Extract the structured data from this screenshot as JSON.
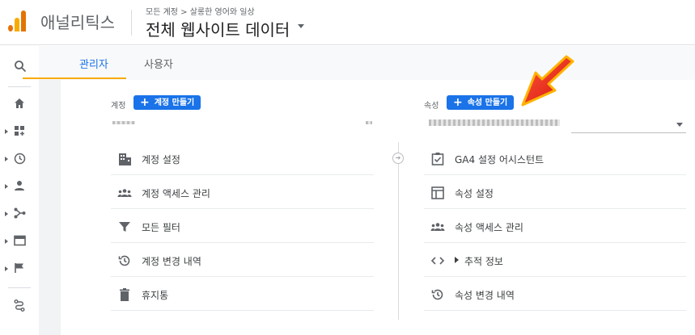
{
  "header": {
    "brand": "애널리틱스",
    "breadcrumb": "모든 계정 > 살롱한 영어와 일상",
    "property_title": "전체 웹사이트 데이터"
  },
  "tabs": [
    {
      "label": "관리자",
      "active": true
    },
    {
      "label": "사용자",
      "active": false
    }
  ],
  "rail": {
    "icons": [
      "search-icon",
      "home-icon",
      "dashboard-icon",
      "realtime-icon",
      "audience-icon",
      "acquisition-icon",
      "behavior-icon",
      "conversions-icon",
      "attribution-icon"
    ]
  },
  "account": {
    "label": "계정",
    "create_button": "계정 만들기",
    "items": [
      {
        "icon": "building-icon",
        "label": "계정 설정"
      },
      {
        "icon": "people-icon",
        "label": "계정 액세스 관리"
      },
      {
        "icon": "filter-icon",
        "label": "모든 필터"
      },
      {
        "icon": "history-icon",
        "label": "계정 변경 내역"
      },
      {
        "icon": "trash-icon",
        "label": "휴지통"
      }
    ]
  },
  "property": {
    "label": "속성",
    "create_button": "속성 만들기",
    "items": [
      {
        "icon": "checkbox-icon",
        "label": "GA4 설정 어시스턴트"
      },
      {
        "icon": "window-icon",
        "label": "속성 설정"
      },
      {
        "icon": "people-icon",
        "label": "속성 액세스 관리"
      },
      {
        "icon": "code-icon",
        "label": "추적 정보"
      },
      {
        "icon": "history-icon",
        "label": "속성 변경 내역"
      }
    ]
  },
  "colors": {
    "accent": "#1a73e8",
    "tab_underline": "#f9ab00",
    "annotation_arrow": "#e8210d"
  }
}
